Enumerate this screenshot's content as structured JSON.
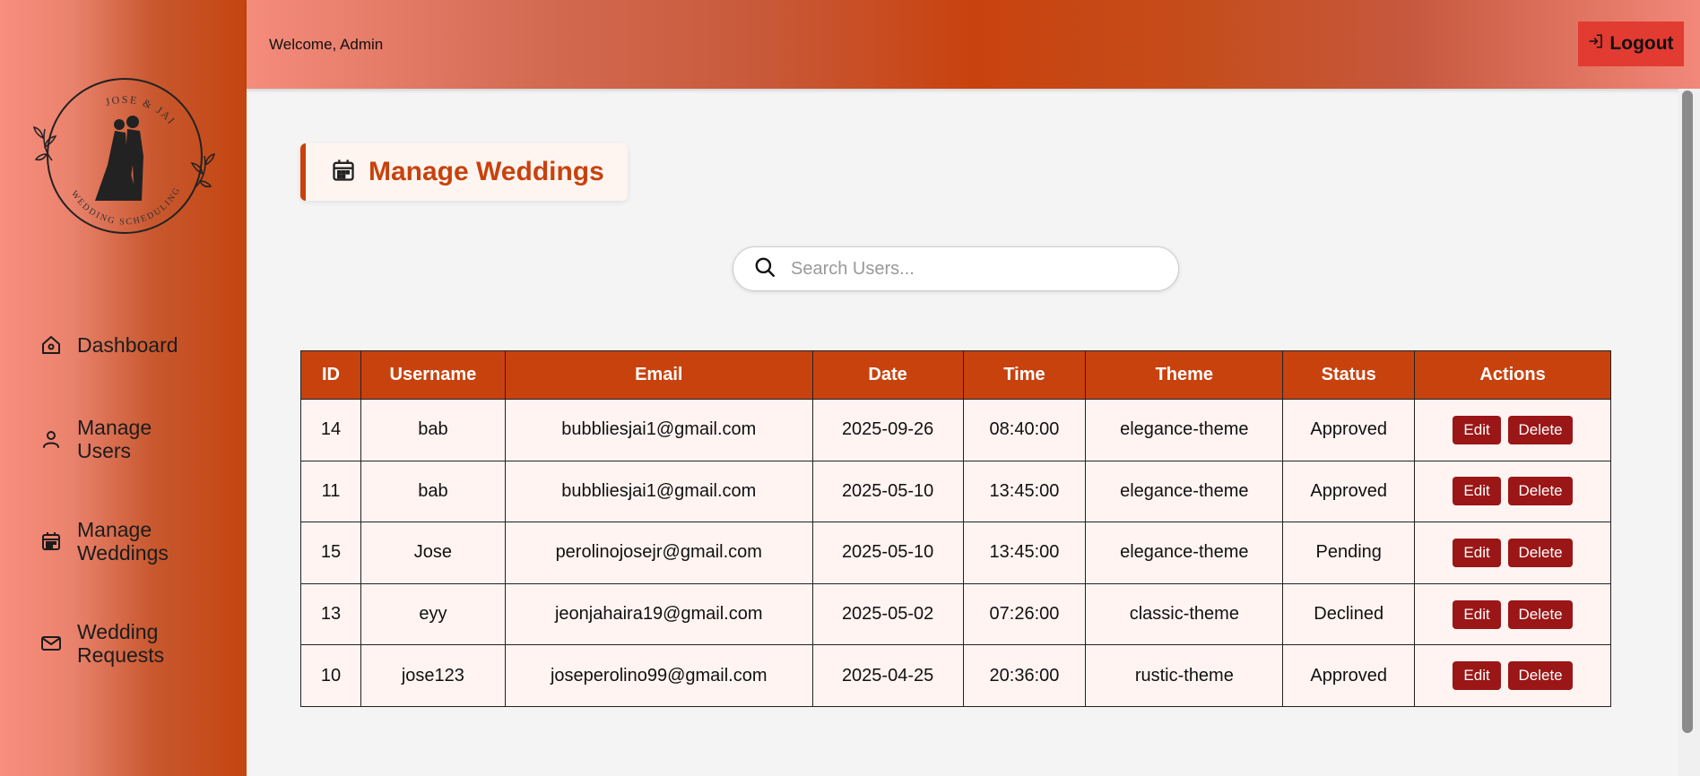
{
  "header": {
    "welcome": "Welcome, Admin",
    "logout_label": "Logout"
  },
  "sidebar": {
    "logo_text_top": "JOSE & JAI",
    "logo_text_bottom": "WEDDING SCHEDULING",
    "items": [
      {
        "label": "Dashboard",
        "icon": "home-icon"
      },
      {
        "label": "Manage Users",
        "icon": "user-icon"
      },
      {
        "label": "Manage Weddings",
        "icon": "calendar-icon"
      },
      {
        "label": "Wedding Requests",
        "icon": "mail-icon"
      }
    ]
  },
  "page": {
    "title": "Manage Weddings",
    "title_icon": "calendar-icon"
  },
  "search": {
    "placeholder": "Search Users..."
  },
  "table": {
    "columns": [
      "ID",
      "Username",
      "Email",
      "Date",
      "Time",
      "Theme",
      "Status",
      "Actions"
    ],
    "edit_label": "Edit",
    "delete_label": "Delete",
    "rows": [
      {
        "id": "14",
        "username": "bab",
        "email": "bubbliesjai1@gmail.com",
        "date": "2025-09-26",
        "time": "08:40:00",
        "theme": "elegance-theme",
        "status": "Approved"
      },
      {
        "id": "11",
        "username": "bab",
        "email": "bubbliesjai1@gmail.com",
        "date": "2025-05-10",
        "time": "13:45:00",
        "theme": "elegance-theme",
        "status": "Approved"
      },
      {
        "id": "15",
        "username": "Jose",
        "email": "perolinojosejr@gmail.com",
        "date": "2025-05-10",
        "time": "13:45:00",
        "theme": "elegance-theme",
        "status": "Pending"
      },
      {
        "id": "13",
        "username": "eyy",
        "email": "jeonjahaira19@gmail.com",
        "date": "2025-05-02",
        "time": "07:26:00",
        "theme": "classic-theme",
        "status": "Declined"
      },
      {
        "id": "10",
        "username": "jose123",
        "email": "joseperolino99@gmail.com",
        "date": "2025-04-25",
        "time": "20:36:00",
        "theme": "rustic-theme",
        "status": "Approved"
      }
    ]
  },
  "colors": {
    "accent": "#c8420e",
    "approved": "#1e8c1e",
    "pending": "#f3a21b",
    "declined": "#e32020",
    "action_button": "#9b1616",
    "logout": "#e13b32"
  }
}
